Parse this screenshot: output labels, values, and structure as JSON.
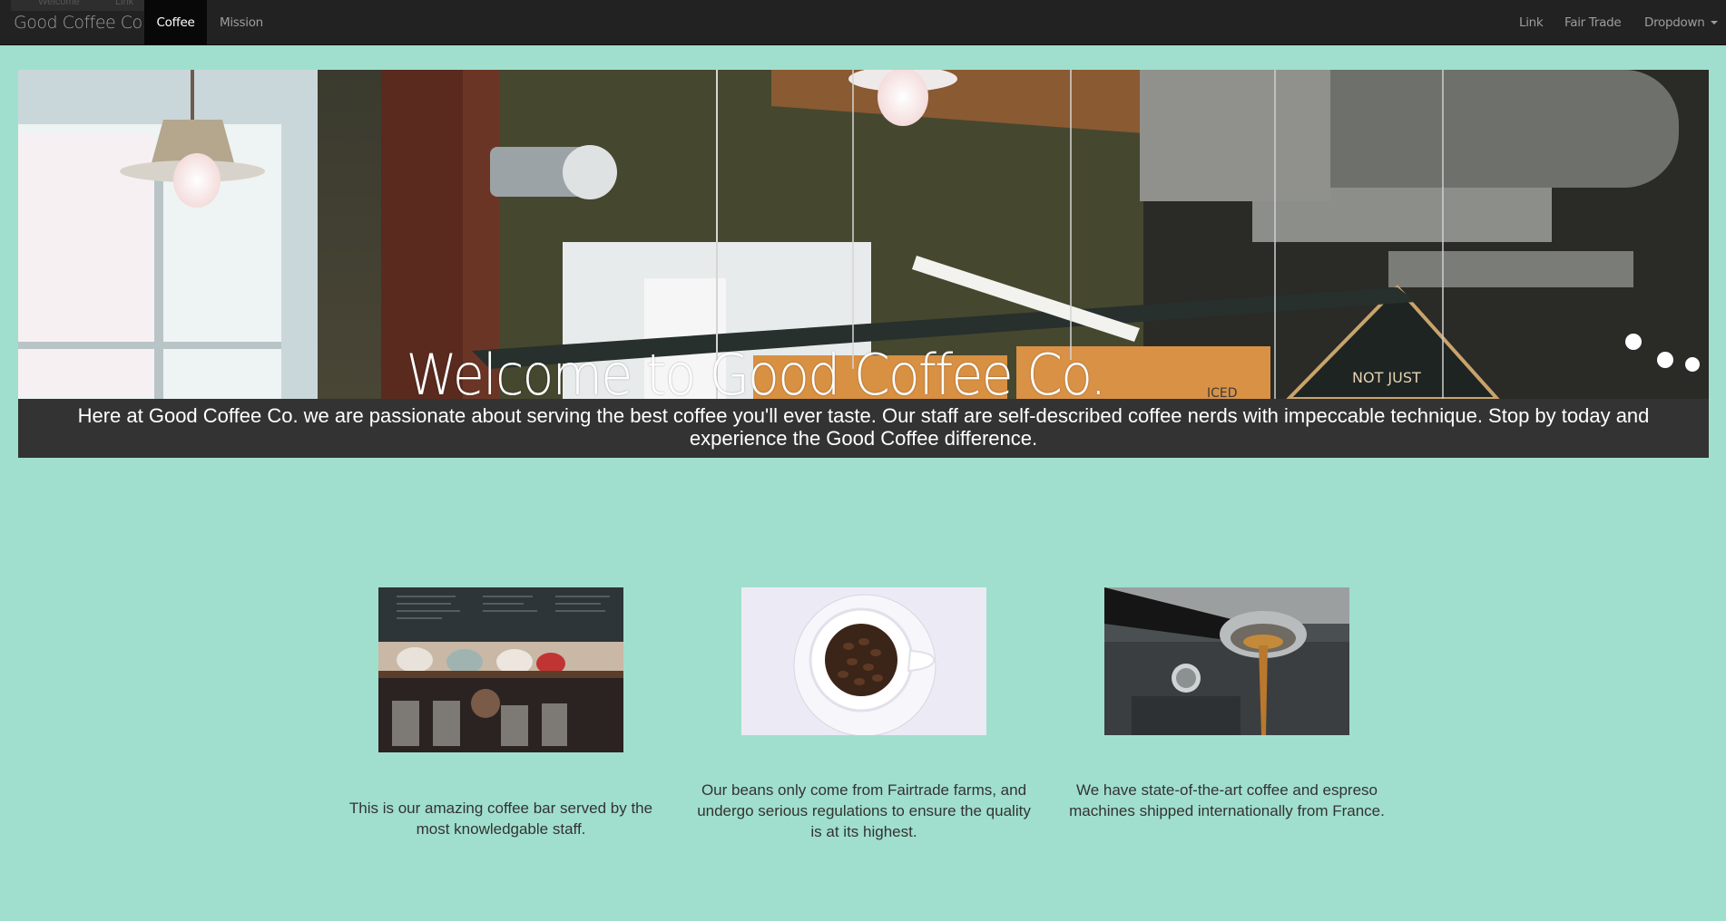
{
  "navbar": {
    "brand": "Good Coffee Co.",
    "ghost_tabs": [
      "Welcome",
      "Link"
    ],
    "left_items": [
      {
        "label": "Coffee",
        "active": true
      },
      {
        "label": "Mission",
        "active": false
      }
    ],
    "right_items": [
      {
        "label": "Link"
      },
      {
        "label": "Fair Trade"
      },
      {
        "label": "Dropdown",
        "has_caret": true
      }
    ]
  },
  "hero": {
    "title": "Welcome to Good Coffee Co.",
    "sign_text": "NOT JUST",
    "sign_text_2": "ICED",
    "caption": "Here at Good Coffee Co. we are passionate about serving the best coffee you'll ever taste. Our staff are self-described coffee nerds with impeccable technique. Stop by today and experience the Good Coffee difference."
  },
  "features": [
    {
      "image": "coffee-bar-photo",
      "text": "This is our amazing coffee bar served by the most knowledgable staff."
    },
    {
      "image": "coffee-beans-cup-photo",
      "text": "Our beans only come from Fairtrade farms, and undergo serious regulations to ensure the quality is at its highest."
    },
    {
      "image": "espresso-machine-photo",
      "text": "We have state-of-the-art coffee and espreso machines shipped internationally from France."
    }
  ],
  "colors": {
    "page_background": "#a0dfcd",
    "navbar_background": "#222222",
    "navbar_active": "#080808",
    "caption_background": "#333333"
  }
}
